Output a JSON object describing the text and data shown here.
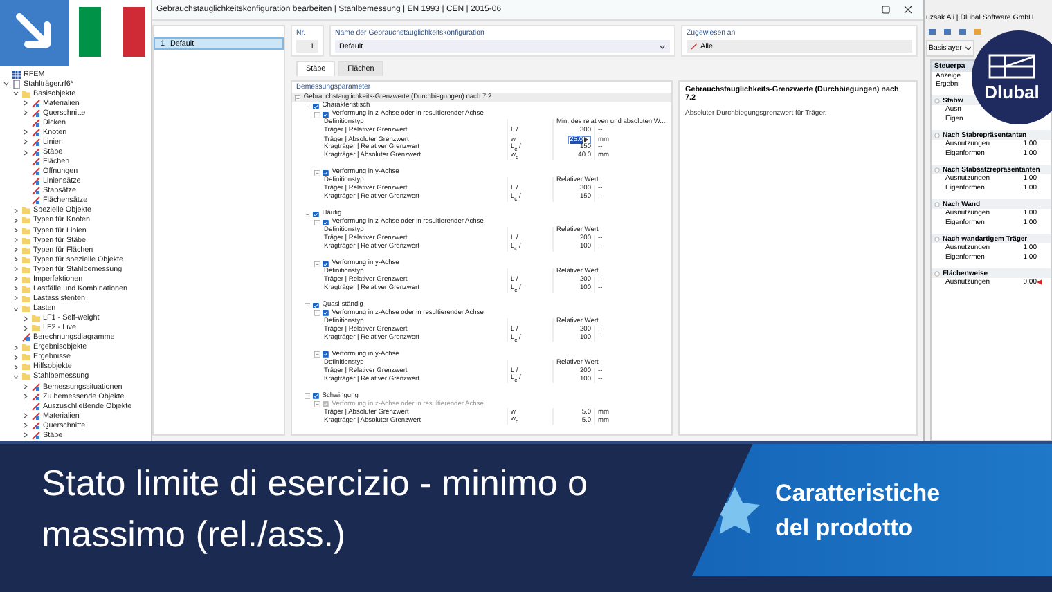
{
  "navigator": {
    "items": [
      {
        "label": "RFEM",
        "kind": "app"
      },
      {
        "label": "Stahlträger.rf6*",
        "kind": "model",
        "expanded": true,
        "children": [
          {
            "label": "Basisobjekte",
            "kind": "folder",
            "expanded": true,
            "children": [
              {
                "label": "Materialien",
                "kind": "object",
                "expanded": false
              },
              {
                "label": "Querschnitte",
                "kind": "object",
                "expanded": false
              },
              {
                "label": "Dicken",
                "kind": "object"
              },
              {
                "label": "Knoten",
                "kind": "object",
                "expanded": false
              },
              {
                "label": "Linien",
                "kind": "object",
                "expanded": false
              },
              {
                "label": "Stäbe",
                "kind": "object",
                "expanded": false
              },
              {
                "label": "Flächen",
                "kind": "object"
              },
              {
                "label": "Öffnungen",
                "kind": "object"
              },
              {
                "label": "Liniensätze",
                "kind": "object"
              },
              {
                "label": "Stabsätze",
                "kind": "object"
              },
              {
                "label": "Flächensätze",
                "kind": "object"
              }
            ]
          },
          {
            "label": "Spezielle Objekte",
            "kind": "folder",
            "expanded": false
          },
          {
            "label": "Typen für Knoten",
            "kind": "folder",
            "expanded": false
          },
          {
            "label": "Typen für Linien",
            "kind": "folder",
            "expanded": false
          },
          {
            "label": "Typen für Stäbe",
            "kind": "folder",
            "expanded": false
          },
          {
            "label": "Typen für Flächen",
            "kind": "folder",
            "expanded": false
          },
          {
            "label": "Typen für spezielle Objekte",
            "kind": "folder",
            "expanded": false
          },
          {
            "label": "Typen für Stahlbemessung",
            "kind": "folder",
            "expanded": false
          },
          {
            "label": "Imperfektionen",
            "kind": "folder",
            "expanded": false
          },
          {
            "label": "Lastfälle und Kombinationen",
            "kind": "folder",
            "expanded": false
          },
          {
            "label": "Lastassistenten",
            "kind": "folder",
            "expanded": false
          },
          {
            "label": "Lasten",
            "kind": "folder",
            "expanded": true,
            "children": [
              {
                "label": "LF1 - Self-weight",
                "kind": "folder",
                "expanded": false
              },
              {
                "label": "LF2 - Live",
                "kind": "folder",
                "expanded": false
              }
            ]
          },
          {
            "label": "Berechnungsdiagramme",
            "kind": "object"
          },
          {
            "label": "Ergebnisobjekte",
            "kind": "folder",
            "expanded": false
          },
          {
            "label": "Ergebnisse",
            "kind": "folder",
            "expanded": false
          },
          {
            "label": "Hilfsobjekte",
            "kind": "folder",
            "expanded": false
          },
          {
            "label": "Stahlbemessung",
            "kind": "folder",
            "expanded": true,
            "children": [
              {
                "label": "Bemessungssituationen",
                "kind": "object",
                "expanded": false
              },
              {
                "label": "Zu bemessende Objekte",
                "kind": "object",
                "expanded": false
              },
              {
                "label": "Auszuschließende Objekte",
                "kind": "object"
              },
              {
                "label": "Materialien",
                "kind": "object",
                "expanded": false
              },
              {
                "label": "Querschnitte",
                "kind": "object",
                "expanded": false
              },
              {
                "label": "Stäbe",
                "kind": "object",
                "expanded": false
              }
            ]
          }
        ]
      }
    ]
  },
  "dialog": {
    "title": "Gebrauchstauglichkeitskonfiguration bearbeiten | Stahlbemessung | EN 1993 | CEN | 2015-06",
    "list": [
      {
        "number": "1",
        "label": "Default",
        "selected": true
      }
    ],
    "nr_label": "Nr.",
    "nr_value": "1",
    "name_label": "Name der Gebrauchstauglichkeitskonfiguration",
    "name_value": "Default",
    "assigned_label": "Zugewiesen an",
    "assigned_value": "Alle",
    "tabs": [
      {
        "label": "Stäbe",
        "selected": true
      },
      {
        "label": "Flächen",
        "selected": false
      }
    ],
    "params_title": "Bemessungsparameter",
    "params": [
      {
        "kind": "group",
        "label": "Gebrauchstauglichkeits-Grenzwerte (Durchbiegungen) nach 7.2",
        "expanded": true,
        "children": [
          {
            "kind": "check",
            "label": "Charakteristisch",
            "checked": true,
            "disabled": false,
            "expanded": true,
            "children": [
              {
                "kind": "check",
                "label": "Verformung in z-Achse oder in resultierender Achse",
                "checked": true,
                "disabled": false,
                "expanded": true,
                "children": [
                  {
                    "kind": "prop",
                    "label": "Definitionstyp",
                    "value": "Min. des relativen und absoluten W..."
                  },
                  {
                    "kind": "prop",
                    "label": "Träger | Relativer Grenzwert",
                    "symbol": "L /",
                    "value": "300",
                    "unit": "--"
                  },
                  {
                    "kind": "input",
                    "label": "Träger | Absoluter Grenzwert",
                    "symbol": "w",
                    "value": "25.0",
                    "unit": "mm"
                  },
                  {
                    "kind": "prop",
                    "label": "Kragträger | Relativer Grenzwert",
                    "symbol": "L$_{c}$ /",
                    "value": "150",
                    "unit": "--"
                  },
                  {
                    "kind": "prop",
                    "label": "Kragträger | Absoluter Grenzwert",
                    "symbol": "w$_{c}$",
                    "value": "40.0",
                    "unit": "mm"
                  }
                ]
              },
              {
                "kind": "check",
                "label": "Verformung in y-Achse",
                "checked": true,
                "disabled": false,
                "expanded": true,
                "children": [
                  {
                    "kind": "prop",
                    "label": "Definitionstyp",
                    "value": "Relativer Wert"
                  },
                  {
                    "kind": "prop",
                    "label": "Träger | Relativer Grenzwert",
                    "symbol": "L /",
                    "value": "300",
                    "unit": "--"
                  },
                  {
                    "kind": "prop",
                    "label": "Kragträger | Relativer Grenzwert",
                    "symbol": "L$_{c}$ /",
                    "value": "150",
                    "unit": "--"
                  }
                ]
              }
            ]
          },
          {
            "kind": "check",
            "label": "Häufig",
            "checked": true,
            "disabled": false,
            "expanded": true,
            "children": [
              {
                "kind": "check",
                "label": "Verformung in z-Achse oder in resultierender Achse",
                "checked": true,
                "disabled": false,
                "expanded": true,
                "children": [
                  {
                    "kind": "prop",
                    "label": "Definitionstyp",
                    "value": "Relativer Wert"
                  },
                  {
                    "kind": "prop",
                    "label": "Träger | Relativer Grenzwert",
                    "symbol": "L /",
                    "value": "200",
                    "unit": "--"
                  },
                  {
                    "kind": "prop",
                    "label": "Kragträger | Relativer Grenzwert",
                    "symbol": "L$_{c}$ /",
                    "value": "100",
                    "unit": "--"
                  }
                ]
              },
              {
                "kind": "check",
                "label": "Verformung in y-Achse",
                "checked": true,
                "disabled": false,
                "expanded": true,
                "children": [
                  {
                    "kind": "prop",
                    "label": "Definitionstyp",
                    "value": "Relativer Wert"
                  },
                  {
                    "kind": "prop",
                    "label": "Träger | Relativer Grenzwert",
                    "symbol": "L /",
                    "value": "200",
                    "unit": "--"
                  },
                  {
                    "kind": "prop",
                    "label": "Kragträger | Relativer Grenzwert",
                    "symbol": "L$_{c}$ /",
                    "value": "100",
                    "unit": "--"
                  }
                ]
              }
            ]
          },
          {
            "kind": "check",
            "label": "Quasi-ständig",
            "checked": true,
            "disabled": false,
            "expanded": true,
            "children": [
              {
                "kind": "check",
                "label": "Verformung in z-Achse oder in resultierender Achse",
                "checked": true,
                "disabled": false,
                "expanded": true,
                "children": [
                  {
                    "kind": "prop",
                    "label": "Definitionstyp",
                    "value": "Relativer Wert"
                  },
                  {
                    "kind": "prop",
                    "label": "Träger | Relativer Grenzwert",
                    "symbol": "L /",
                    "value": "200",
                    "unit": "--"
                  },
                  {
                    "kind": "prop",
                    "label": "Kragträger | Relativer Grenzwert",
                    "symbol": "L$_{c}$ /",
                    "value": "100",
                    "unit": "--"
                  }
                ]
              },
              {
                "kind": "check",
                "label": "Verformung in y-Achse",
                "checked": true,
                "disabled": false,
                "expanded": true,
                "children": [
                  {
                    "kind": "prop",
                    "label": "Definitionstyp",
                    "value": "Relativer Wert"
                  },
                  {
                    "kind": "prop",
                    "label": "Träger | Relativer Grenzwert",
                    "symbol": "L /",
                    "value": "200",
                    "unit": "--"
                  },
                  {
                    "kind": "prop",
                    "label": "Kragträger | Relativer Grenzwert",
                    "symbol": "L$_{c}$ /",
                    "value": "100",
                    "unit": "--"
                  }
                ]
              }
            ]
          },
          {
            "kind": "check",
            "label": "Schwingung",
            "checked": true,
            "disabled": false,
            "expanded": true,
            "children": [
              {
                "kind": "check",
                "label": "Verformung in z-Achse oder in resultierender Achse",
                "checked": true,
                "disabled": true,
                "expanded": true,
                "children": [
                  {
                    "kind": "prop",
                    "label": "Träger | Absoluter Grenzwert",
                    "symbol": "w",
                    "value": "5.0",
                    "unit": "mm"
                  },
                  {
                    "kind": "prop",
                    "label": "Kragträger | Absoluter Grenzwert",
                    "symbol": "w$_{c}$",
                    "value": "5.0",
                    "unit": "mm"
                  }
                ]
              }
            ]
          }
        ]
      }
    ],
    "info_title": "Gebrauchstauglichkeits-Grenzwerte (Durchbiegungen) nach 7.2",
    "info_text": "Absoluter Durchbiegungsgrenzwert für Träger."
  },
  "app": {
    "title": "uzsak Ali | Dlubal Software GmbH",
    "layer": "Basislayer"
  },
  "control_panel": {
    "title": "Steuerpa",
    "lines": [
      "Anzeige",
      "Ergebni"
    ],
    "groups": [
      {
        "label": "Stabw",
        "rows": [
          {
            "label": "Ausn"
          },
          {
            "label": "Eigen"
          }
        ]
      },
      {
        "label": "Nach Stabrepräsentanten",
        "rows": [
          {
            "label": "Ausnutzungen",
            "value": "1.00",
            "warning": false
          },
          {
            "label": "Eigenformen",
            "value": "1.00",
            "warning": false
          }
        ]
      },
      {
        "label": "Nach Stabsatzrepräsentanten",
        "rows": [
          {
            "label": "Ausnutzungen",
            "value": "1.00",
            "warning": false
          },
          {
            "label": "Eigenformen",
            "value": "1.00",
            "warning": false
          }
        ]
      },
      {
        "label": "Nach Wand",
        "rows": [
          {
            "label": "Ausnutzungen",
            "value": "1.00",
            "warning": false
          },
          {
            "label": "Eigenformen",
            "value": "1.00",
            "warning": false
          }
        ]
      },
      {
        "label": "Nach wandartigem Träger",
        "rows": [
          {
            "label": "Ausnutzungen",
            "value": "1.00",
            "warning": false
          },
          {
            "label": "Eigenformen",
            "value": "1.00",
            "warning": false
          }
        ]
      },
      {
        "label": "Flächenweise",
        "rows": [
          {
            "label": "Ausnutzungen",
            "value": "0.00",
            "warning": true
          }
        ]
      }
    ]
  },
  "logo": {
    "text": "Dlubal"
  },
  "banner": {
    "title": "Stato limite di esercizio - minimo o massimo (rel./ass.)",
    "tag": "Caratteristiche del prodotto"
  }
}
